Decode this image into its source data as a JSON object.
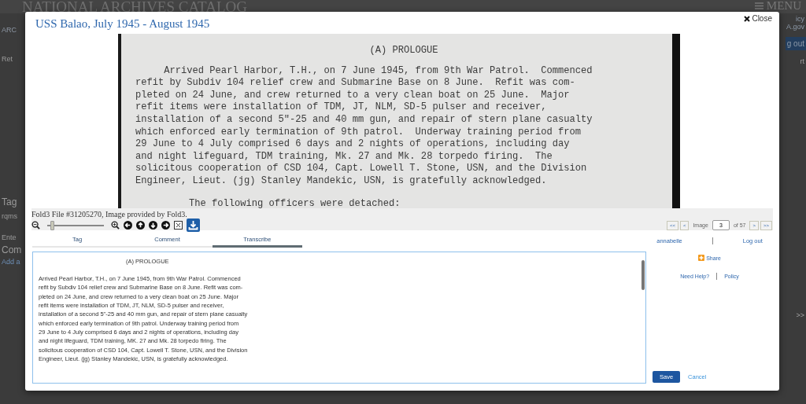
{
  "background_page": {
    "site_title": "NATIONAL ARCHIVES CATALOG",
    "menu": "MENU",
    "left_fragments": [
      "ARC",
      "Ret",
      "Tag",
      "rqms",
      "Ente",
      "Com",
      "Add a"
    ],
    "right_fragments": [
      "icy",
      "A.gov",
      "g out",
      "rt",
      ">>"
    ]
  },
  "dialog": {
    "title": "USS Balao, July 1945 - August 1945",
    "close": "Close"
  },
  "document": {
    "heading": "(A) PROLOGUE",
    "paragraph": [
      "Arrived Pearl Harbor, T.H., on 7 June 1945, from 9th War Patrol.  Commenced",
      "refit by Subdiv 104 relief crew and Submarine Base on 8 June.  Refit was com-",
      "pleted on 24 June, and crew returned to a very clean boat on 25 June.  Major",
      "refit items were installation of TDM, JT, NLM, SD-5 pulser and receiver,",
      "installation of a second 5\"-25 and 40 mm gun, and repair of stern plane casualty",
      "which enforced early termination of 9th patrol.  Underway training period from",
      "29 June to 4 July comprised 6 days and 2 nights of operations, including day",
      "and night lifeguard, TDM training, Mk. 27 and Mk. 28 torpedo firing.  The",
      "solicitous cooperation of CSD 104, Capt. Lowell T. Stone, USN, and the Division",
      "Engineer, Lieut. (jg) Stanley Mandekic, USN, is gratefully acknowledged."
    ],
    "following": "The following officers were detached:"
  },
  "caption": "Fold3 File #31205270, Image provided by Fold3.",
  "zoom": {
    "level": 0.05
  },
  "pager": {
    "first": "<<",
    "prev": "<",
    "label": "Image",
    "value": "3",
    "total": "of 57",
    "next": ">",
    "last": ">>"
  },
  "tabs": [
    {
      "label": "Tag",
      "selected": false
    },
    {
      "label": "Comment",
      "selected": false
    },
    {
      "label": "Transcribe",
      "selected": true
    }
  ],
  "transcription": {
    "heading": "(A) PROLOGUE",
    "lines": [
      "Arrived Pearl Harbor, T.H., on 7 June 1945, from 9th War Patrol. Commenced",
      "refit by Subdiv 104 relief crew and Submarine Base on 8 June. Refit was com-",
      "pleted on 24 June, and crew returned to a very clean boat on 25 June. Major",
      "refit items were installation of TDM, JT, NLM, SD-5 pulser and receiver,",
      "installation of a second 5\"-25 and 40 mm gun, and repair of stern plane casualty",
      "which enforced early termination of 9th patrol. Underway training period from",
      "29 June to 4 July comprised 6 days and 2 nights of operations, including day",
      "and night lifeguard, TDM training, MK. 27 and Mk. 28 torpedo firing. The",
      "solicitous cooperation of CSD 104, Capt. Lowell T. Stone, USN, and the Division",
      "Engineer, Lieut. (jg) Stanley Mandekic, USN, is gratefully acknowledged."
    ]
  },
  "user": {
    "name": "annabelle",
    "logout": "Log out"
  },
  "share": "Share",
  "help_links": [
    "Need Help?",
    "Policy"
  ],
  "actions": {
    "save": "Save",
    "cancel": "Cancel"
  }
}
